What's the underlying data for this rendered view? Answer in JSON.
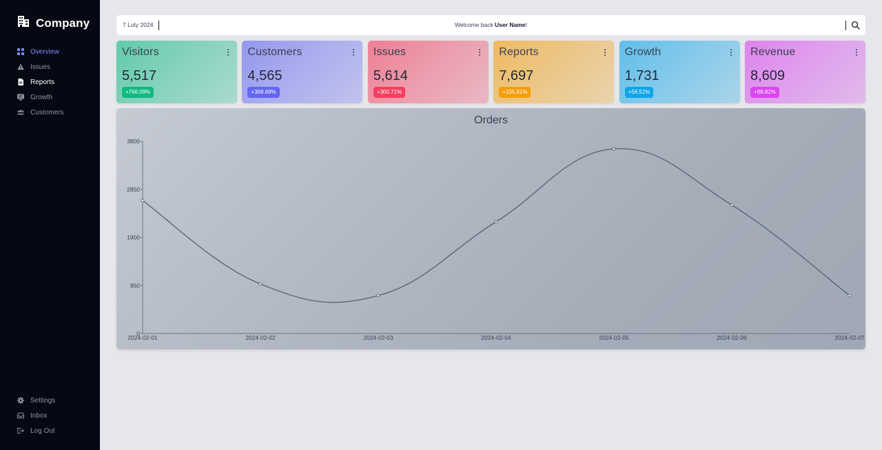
{
  "brand": {
    "name": "Company",
    "icon": "building-icon"
  },
  "sidebar": {
    "items": [
      {
        "label": "Overview",
        "icon": "grid-icon"
      },
      {
        "label": "Issues",
        "icon": "warning-icon"
      },
      {
        "label": "Reports",
        "icon": "document-icon"
      },
      {
        "label": "Growth",
        "icon": "chart-board-icon"
      },
      {
        "label": "Customers",
        "icon": "users-icon"
      }
    ],
    "bottom_items": [
      {
        "label": "Settings",
        "icon": "gear-icon"
      },
      {
        "label": "Inbox",
        "icon": "inbox-icon"
      },
      {
        "label": "Log Out",
        "icon": "logout-icon"
      }
    ]
  },
  "topbar": {
    "date": "7 Luty 2024",
    "welcome_prefix": "Welcome back ",
    "user_name": "User Name",
    "welcome_suffix": "!",
    "search_icon": "search-icon"
  },
  "cards": [
    {
      "title": "Visitors",
      "value": "5,517",
      "change": "+766.09%",
      "accent": "#10b981"
    },
    {
      "title": "Customers",
      "value": "4,565",
      "change": "+368.69%",
      "accent": "#6366f1"
    },
    {
      "title": "Issues",
      "value": "5,614",
      "change": "+300.71%",
      "accent": "#f43f5e"
    },
    {
      "title": "Reports",
      "value": "7,697",
      "change": "+105.91%",
      "accent": "#f59e0b"
    },
    {
      "title": "Growth",
      "value": "1,731",
      "change": "+56.51%",
      "accent": "#0ea5e9"
    },
    {
      "title": "Revenue",
      "value": "8,609",
      "change": "+96.82%",
      "accent": "#d946ef"
    }
  ],
  "chart_data": {
    "type": "line",
    "title": "Orders",
    "x": [
      "2024-02-01",
      "2024-02-02",
      "2024-02-03",
      "2024-02-04",
      "2024-02-05",
      "2024-02-06",
      "2024-02-07"
    ],
    "y_ticks": [
      0,
      950,
      1900,
      2850,
      3800
    ],
    "ylim": [
      0,
      3800
    ],
    "series": [
      {
        "values": [
          2630,
          980,
          750,
          2210,
          3650,
          2540,
          750
        ]
      }
    ],
    "line_color": "#5b6676",
    "grid": false,
    "legend": "none"
  }
}
